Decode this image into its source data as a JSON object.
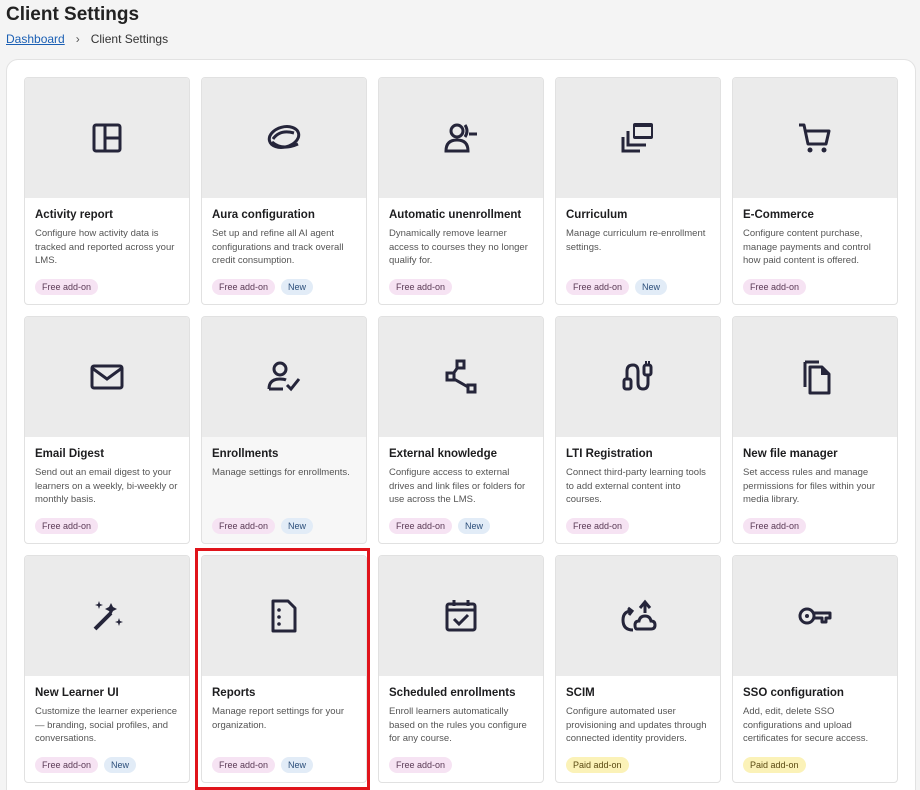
{
  "page": {
    "title": "Client Settings"
  },
  "breadcrumb": {
    "home": "Dashboard",
    "separator": "›",
    "current": "Client Settings"
  },
  "cards": [
    {
      "title": "Activity report",
      "desc": "Configure how activity data is tracked and reported across your LMS.",
      "icon": "layout-icon",
      "badges": [
        {
          "label": "Free add-on",
          "kind": "free"
        }
      ]
    },
    {
      "title": "Aura configuration",
      "desc": "Set up and refine all AI agent configurations and track overall credit consumption.",
      "icon": "aura-icon",
      "badges": [
        {
          "label": "Free add-on",
          "kind": "free"
        },
        {
          "label": "New",
          "kind": "new"
        }
      ]
    },
    {
      "title": "Automatic unenrollment",
      "desc": "Dynamically remove learner access to courses they no longer qualify for.",
      "icon": "user-remove-icon",
      "badges": [
        {
          "label": "Free add-on",
          "kind": "free"
        }
      ]
    },
    {
      "title": "Curriculum",
      "desc": "Manage curriculum re-enrollment settings.",
      "icon": "library-icon",
      "badges": [
        {
          "label": "Free add-on",
          "kind": "free"
        },
        {
          "label": "New",
          "kind": "new"
        }
      ]
    },
    {
      "title": "E-Commerce",
      "desc": "Configure content purchase, manage payments and control how paid content is offered.",
      "icon": "cart-icon",
      "badges": [
        {
          "label": "Free add-on",
          "kind": "free"
        }
      ]
    },
    {
      "title": "Email Digest",
      "desc": "Send out an email digest to your learners on a weekly, bi-weekly or monthly basis.",
      "icon": "mail-icon",
      "badges": [
        {
          "label": "Free add-on",
          "kind": "free"
        }
      ]
    },
    {
      "title": "Enrollments",
      "desc": "Manage settings for enrollments.",
      "icon": "user-check-icon",
      "badges": [
        {
          "label": "Free add-on",
          "kind": "free"
        },
        {
          "label": "New",
          "kind": "new"
        }
      ]
    },
    {
      "title": "External knowledge",
      "desc": "Configure access to external drives and link files or folders for use across the LMS.",
      "icon": "share-nodes-icon",
      "badges": [
        {
          "label": "Free add-on",
          "kind": "free"
        },
        {
          "label": "New",
          "kind": "new"
        }
      ]
    },
    {
      "title": "LTI Registration",
      "desc": "Connect third-party learning tools to add external content into courses.",
      "icon": "plug-icon",
      "badges": [
        {
          "label": "Free add-on",
          "kind": "free"
        }
      ]
    },
    {
      "title": "New file manager",
      "desc": "Set access rules and manage permissions for files within your media library.",
      "icon": "files-icon",
      "badges": [
        {
          "label": "Free add-on",
          "kind": "free"
        }
      ]
    },
    {
      "title": "New Learner UI",
      "desc": "Customize the learner experience — branding, social profiles, and conversations.",
      "icon": "magic-wand-icon",
      "badges": [
        {
          "label": "Free add-on",
          "kind": "free"
        },
        {
          "label": "New",
          "kind": "new"
        }
      ]
    },
    {
      "title": "Reports",
      "desc": "Manage report settings for your organization.",
      "icon": "report-icon",
      "badges": [
        {
          "label": "Free add-on",
          "kind": "free"
        },
        {
          "label": "New",
          "kind": "new"
        }
      ]
    },
    {
      "title": "Scheduled enrollments",
      "desc": "Enroll learners automatically based on the rules you configure for any course.",
      "icon": "calendar-check-icon",
      "badges": [
        {
          "label": "Free add-on",
          "kind": "free"
        }
      ]
    },
    {
      "title": "SCIM",
      "desc": "Configure automated user provisioning and updates through connected identity providers.",
      "icon": "cloud-sync-icon",
      "badges": [
        {
          "label": "Paid add-on",
          "kind": "paid"
        }
      ]
    },
    {
      "title": "SSO configuration",
      "desc": "Add, edit, delete SSO configurations and upload certificates for secure access.",
      "icon": "key-icon",
      "badges": [
        {
          "label": "Paid add-on",
          "kind": "paid"
        }
      ]
    }
  ],
  "colors": {
    "highlight": "#e0141b",
    "link": "#1a5fb4",
    "icon": "#25253a"
  }
}
